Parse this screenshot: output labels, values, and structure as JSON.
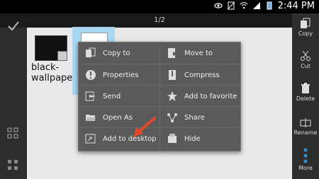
{
  "status": {
    "time": "2:44 PM"
  },
  "toolbar": {
    "page_indicator": "1/2"
  },
  "files": [
    {
      "label": "black-wallpaper-"
    }
  ],
  "menu": {
    "items": [
      {
        "label": "Copy to",
        "icon": "copy-to-icon"
      },
      {
        "label": "Move to",
        "icon": "move-to-icon"
      },
      {
        "label": "Properties",
        "icon": "info-icon"
      },
      {
        "label": "Compress",
        "icon": "compress-icon"
      },
      {
        "label": "Send",
        "icon": "send-icon"
      },
      {
        "label": "Add to favorite",
        "icon": "star-icon"
      },
      {
        "label": "Open As",
        "icon": "folder-open-icon"
      },
      {
        "label": "Share",
        "icon": "share-icon"
      },
      {
        "label": "Add to desktop",
        "icon": "desktop-shortcut-icon"
      },
      {
        "label": "Hide",
        "icon": "hide-icon"
      }
    ]
  },
  "right_actions": [
    {
      "label": "Copy",
      "icon": "copy-icon"
    },
    {
      "label": "Cut",
      "icon": "scissors-icon"
    },
    {
      "label": "Delete",
      "icon": "trash-icon"
    },
    {
      "label": "Rename",
      "icon": "rename-icon"
    },
    {
      "label": "More",
      "icon": "more-icon"
    }
  ],
  "colors": {
    "accent_blue": "#2f8fd0",
    "annotation_arrow": "#e04a2a",
    "menu_bg": "#5a5a5a"
  }
}
